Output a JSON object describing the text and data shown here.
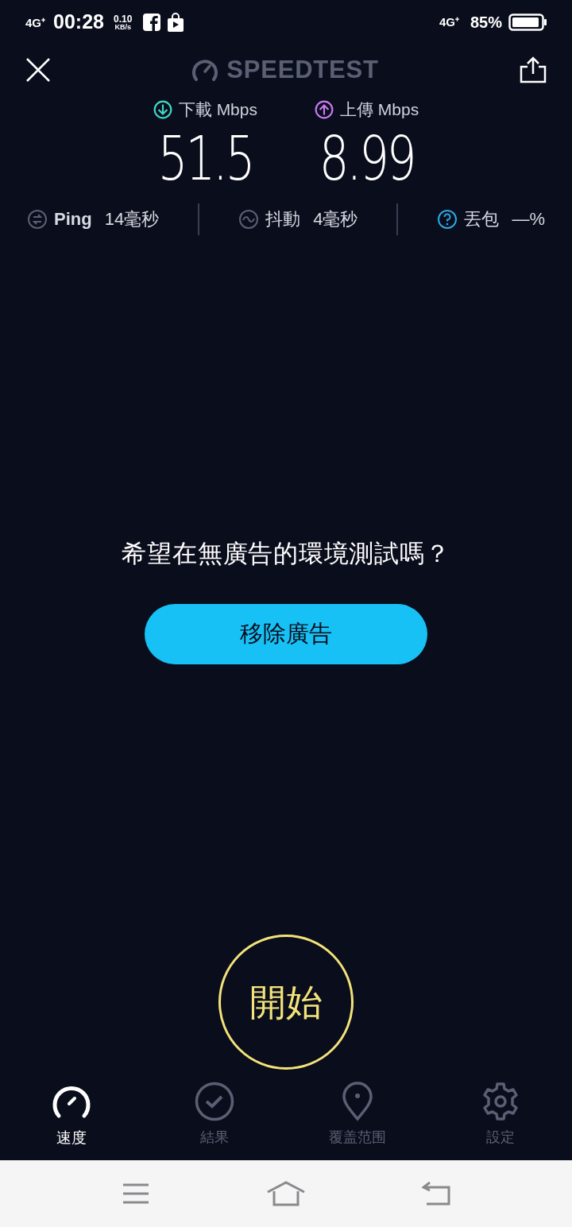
{
  "status_bar": {
    "network": "4G⁺",
    "time": "00:28",
    "speed_value": "0.10",
    "speed_unit": "KB/s",
    "network_right": "4G⁺",
    "battery": "85%"
  },
  "header": {
    "title": "SPEEDTEST"
  },
  "results": [
    {
      "kind": "download",
      "label": "下載 Mbps",
      "value": "51.5",
      "color": "#3fd8c8"
    },
    {
      "kind": "upload",
      "label": "上傳 Mbps",
      "value": "8.99",
      "color": "#c87af0"
    }
  ],
  "stats": [
    {
      "kind": "ping",
      "label": "Ping",
      "value": "14毫秒"
    },
    {
      "kind": "jitter",
      "label": "抖動",
      "value": "4毫秒"
    },
    {
      "kind": "loss",
      "label": "丟包",
      "value": "—%"
    }
  ],
  "promo": {
    "text": "希望在無廣告的環境測試嗎？",
    "button": "移除廣告"
  },
  "start_button": "開始",
  "tabs": [
    {
      "kind": "speed",
      "label": "速度",
      "selected": true
    },
    {
      "kind": "results",
      "label": "結果",
      "selected": false
    },
    {
      "kind": "coverage",
      "label": "覆盖范围",
      "selected": false
    },
    {
      "kind": "settings",
      "label": "設定",
      "selected": false
    }
  ]
}
